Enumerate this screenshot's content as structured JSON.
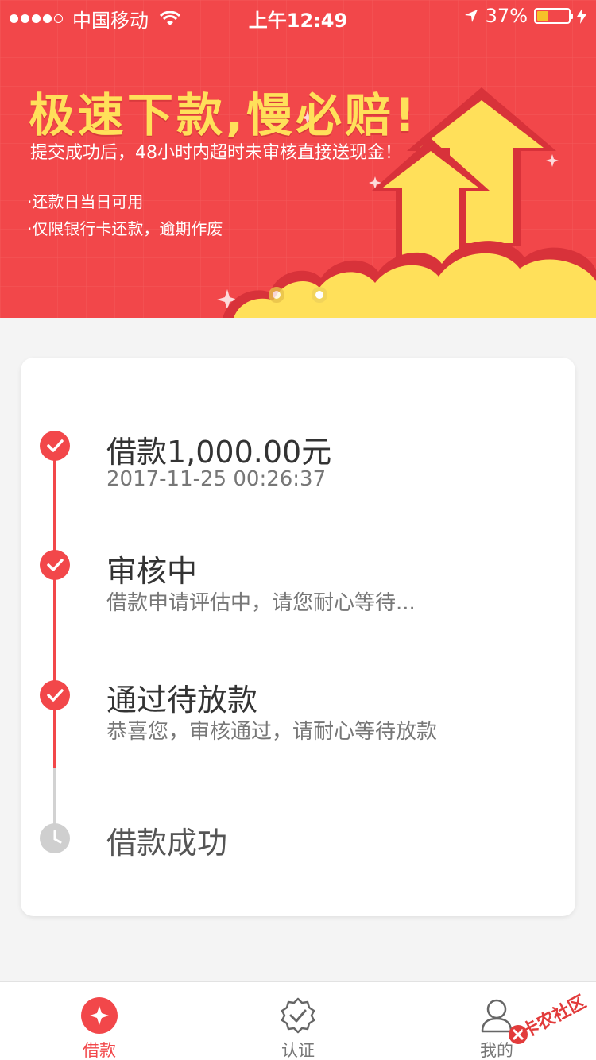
{
  "status_bar": {
    "carrier": "中国移动",
    "time": "上午12:49",
    "battery_percent": "37%",
    "battery_level": 0.37
  },
  "banner": {
    "title": "极速下款,慢必赔!",
    "subtitle": "提交成功后，48小时内超时未审核直接送现金！",
    "bullets": [
      "·还款日当日可用",
      "·仅限银行卡还款，逾期作废"
    ],
    "page_count": 2,
    "active_page": 0
  },
  "progress": {
    "steps": [
      {
        "title": "借款1,000.00元",
        "desc": "2017-11-25 00:26:37",
        "state": "done"
      },
      {
        "title": "审核中",
        "desc": "借款申请评估中，请您耐心等待...",
        "state": "done"
      },
      {
        "title": "通过待放款",
        "desc": "恭喜您，审核通过，请耐心等待放款",
        "state": "done"
      },
      {
        "title": "借款成功",
        "desc": "",
        "state": "pending"
      }
    ]
  },
  "tabbar": {
    "items": [
      {
        "label": "借款",
        "icon": "loan-icon",
        "active": true
      },
      {
        "label": "认证",
        "icon": "verify-badge-icon",
        "active": false
      },
      {
        "label": "我的",
        "icon": "user-icon",
        "active": false
      }
    ]
  },
  "watermark": {
    "text": "卡农社区"
  },
  "colors": {
    "primary": "#f2474a",
    "banner_yellow": "#ffe05a",
    "pending_gray": "#cfcfcf",
    "text_dark": "#333333",
    "text_muted": "#777777"
  }
}
